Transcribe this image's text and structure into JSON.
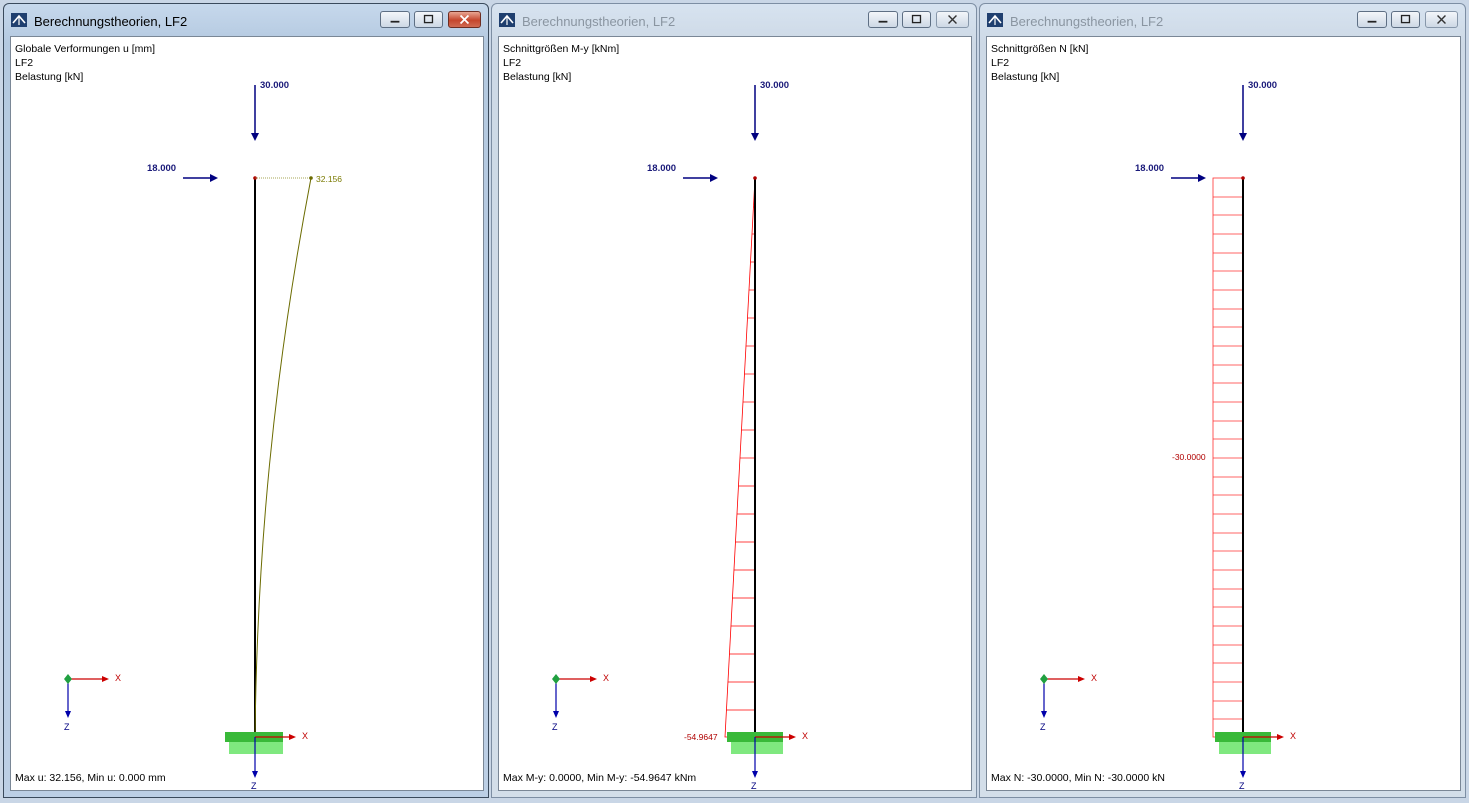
{
  "windows": [
    {
      "title": "Berechnungstheorien, LF2",
      "active": true,
      "info": [
        "Globale Verformungen u [mm]",
        "LF2",
        "Belastung [kN]"
      ],
      "load_vertical": "30.000",
      "load_horizontal": "18.000",
      "result_label": "32.156",
      "status": "Max u: 32.156, Min u: 0.000 mm",
      "axis_x": "X",
      "axis_z": "Z"
    },
    {
      "title": "Berechnungstheorien, LF2",
      "active": false,
      "info": [
        "Schnittgrößen M-y [kNm]",
        "LF2",
        "Belastung [kN]"
      ],
      "load_vertical": "30.000",
      "load_horizontal": "18.000",
      "result_label": "-54.9647",
      "status": "Max M-y: 0.0000, Min M-y: -54.9647 kNm",
      "axis_x": "X",
      "axis_z": "Z"
    },
    {
      "title": "Berechnungstheorien, LF2",
      "active": false,
      "info": [
        "Schnittgrößen N [kN]",
        "LF2",
        "Belastung [kN]"
      ],
      "load_vertical": "30.000",
      "load_horizontal": "18.000",
      "result_label": "-30.0000",
      "status": "Max N: -30.0000, Min N: -30.0000 kN",
      "axis_x": "X",
      "axis_z": "Z"
    }
  ],
  "icons": [
    "app-icon",
    "minimize-icon",
    "maximize-icon",
    "close-icon"
  ],
  "colors": {
    "load": "#000080",
    "member": "#000000",
    "deformation": "#6b6b00",
    "internal_force": "#ff0000",
    "support": "#39d339",
    "axis_x": "#cc0000",
    "axis_z": "#0000aa"
  }
}
